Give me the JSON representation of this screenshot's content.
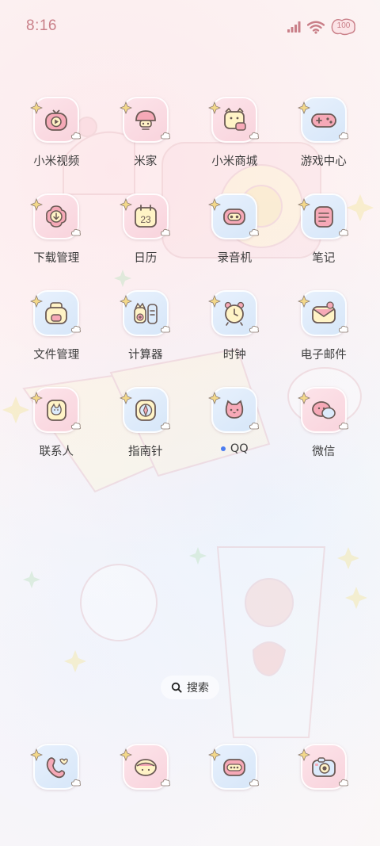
{
  "status_bar": {
    "time": "8:16",
    "battery": "100",
    "icons": [
      "signal-icon",
      "wifi-icon",
      "battery-icon"
    ]
  },
  "apps": [
    {
      "label": "小米视频",
      "icon": "video-play-icon",
      "bg": "pink"
    },
    {
      "label": "米家",
      "icon": "lamp-icon",
      "bg": "pink"
    },
    {
      "label": "小米商城",
      "icon": "shopping-bag-icon",
      "bg": "pink"
    },
    {
      "label": "游戏中心",
      "icon": "gamepad-icon",
      "bg": "blue"
    },
    {
      "label": "下载管理",
      "icon": "download-icon",
      "bg": "pink"
    },
    {
      "label": "日历",
      "icon": "calendar-icon",
      "bg": "pink",
      "date": "23"
    },
    {
      "label": "录音机",
      "icon": "recorder-icon",
      "bg": "blue"
    },
    {
      "label": "笔记",
      "icon": "notes-icon",
      "bg": "blue"
    },
    {
      "label": "文件管理",
      "icon": "folder-icon",
      "bg": "blue"
    },
    {
      "label": "计算器",
      "icon": "calculator-icon",
      "bg": "blue"
    },
    {
      "label": "时钟",
      "icon": "clock-icon",
      "bg": "blue"
    },
    {
      "label": "电子邮件",
      "icon": "mail-icon",
      "bg": "blue"
    },
    {
      "label": "联系人",
      "icon": "contacts-icon",
      "bg": "pink"
    },
    {
      "label": "指南针",
      "icon": "compass-icon",
      "bg": "blue"
    },
    {
      "label": "QQ",
      "icon": "qq-icon",
      "bg": "blue",
      "notification_dot": true
    },
    {
      "label": "微信",
      "icon": "wechat-icon",
      "bg": "pink"
    }
  ],
  "search": {
    "label": "搜索",
    "icon": "search-icon"
  },
  "dock": [
    {
      "icon": "phone-icon",
      "bg": "blue"
    },
    {
      "icon": "messages-icon",
      "bg": "pink"
    },
    {
      "icon": "browser-icon",
      "bg": "blue"
    },
    {
      "icon": "camera-icon",
      "bg": "pink"
    }
  ],
  "colors": {
    "accent_pink": "#c97f88",
    "label_text": "#3d3d3d",
    "notification_dot": "#4a7cf0",
    "icon_bg_pink": "#f8d3dc",
    "icon_bg_blue": "#d6e6f8"
  }
}
